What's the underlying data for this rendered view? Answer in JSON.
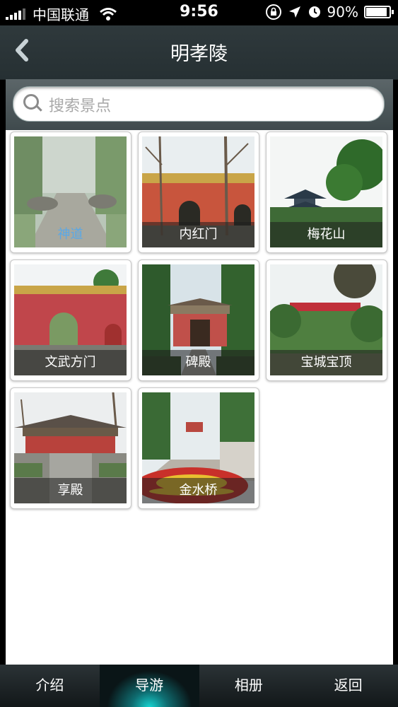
{
  "status_bar": {
    "carrier": "中国联通",
    "time": "9:56",
    "battery": "90%",
    "battery_level": 0.9
  },
  "header": {
    "title": "明孝陵"
  },
  "search": {
    "placeholder": "搜索景点"
  },
  "spots": [
    {
      "name": "神道",
      "icon": "photo-shendao"
    },
    {
      "name": "内红门",
      "icon": "photo-neihongmen"
    },
    {
      "name": "梅花山",
      "icon": "photo-meihuashan"
    },
    {
      "name": "文武方门",
      "icon": "photo-wenwufangmen"
    },
    {
      "name": "碑殿",
      "icon": "photo-beidian"
    },
    {
      "name": "宝城宝顶",
      "icon": "photo-baochengbaoding"
    },
    {
      "name": "享殿",
      "icon": "photo-xiangdian"
    },
    {
      "name": "金水桥",
      "icon": "photo-jinshuiqiao"
    }
  ],
  "tabs": [
    {
      "label": "介绍",
      "active": false
    },
    {
      "label": "导游",
      "active": true
    },
    {
      "label": "相册",
      "active": false
    },
    {
      "label": "返回",
      "active": false
    }
  ],
  "colors": {
    "nav_bg": "#2f393c",
    "tab_active": "#16d3d0"
  }
}
